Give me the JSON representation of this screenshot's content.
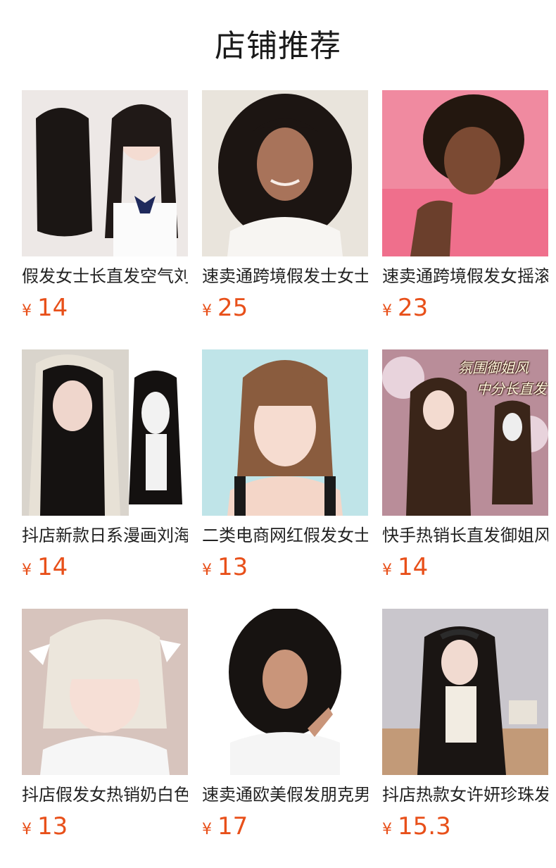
{
  "header": {
    "title": "店铺推荐"
  },
  "currency_symbol": "¥",
  "products": [
    {
      "name": "假发女士长直发空气刘海",
      "price": "14"
    },
    {
      "name": "速卖通跨境假发士女士",
      "price": "25"
    },
    {
      "name": "速卖通跨境假发女摇滚",
      "price": "23"
    },
    {
      "name": "抖店新款日系漫画刘海",
      "price": "14"
    },
    {
      "name": "二类电商网红假发女士",
      "price": "13"
    },
    {
      "name": "快手热销长直发御姐风",
      "price": "14",
      "overlay": [
        "氛围御姐风",
        "中分长直发"
      ]
    },
    {
      "name": "抖店假发女热销奶白色",
      "price": "13"
    },
    {
      "name": "速卖通欧美假发朋克男",
      "price": "17"
    },
    {
      "name": "抖店热款女许妍珍珠发箍",
      "price": "15.3"
    }
  ],
  "colors": {
    "price": "#e8501a",
    "title": "#1a1a1a"
  }
}
